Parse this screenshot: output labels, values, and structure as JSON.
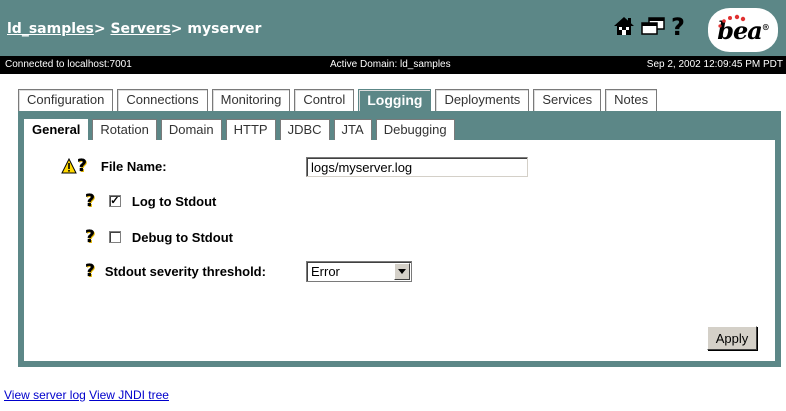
{
  "breadcrumb": {
    "domain": "ld_samples",
    "sep1": ">",
    "servers": "Servers",
    "sep2": ">",
    "server": "myserver"
  },
  "header": {
    "icons": [
      "home-icon",
      "windows-icon",
      "help-icon"
    ],
    "help_glyph": "?",
    "logo_text": "bea",
    "logo_mark": "®",
    "colors": {
      "header_bg": "#5c8787",
      "status_bg": "#000000",
      "link": "#0000cc"
    }
  },
  "status": {
    "connection": "Connected to localhost:7001",
    "domain": "Active Domain: ld_samples",
    "timestamp": "Sep 2, 2002 12:09:45 PM PDT"
  },
  "tabs": [
    {
      "label": "Configuration",
      "active": false
    },
    {
      "label": "Connections",
      "active": false
    },
    {
      "label": "Monitoring",
      "active": false
    },
    {
      "label": "Control",
      "active": false
    },
    {
      "label": "Logging",
      "active": true
    },
    {
      "label": "Deployments",
      "active": false
    },
    {
      "label": "Services",
      "active": false
    },
    {
      "label": "Notes",
      "active": false
    }
  ],
  "subtabs": [
    {
      "label": "General",
      "active": true
    },
    {
      "label": "Rotation",
      "active": false
    },
    {
      "label": "Domain",
      "active": false
    },
    {
      "label": "HTTP",
      "active": false
    },
    {
      "label": "JDBC",
      "active": false
    },
    {
      "label": "JTA",
      "active": false
    },
    {
      "label": "Debugging",
      "active": false
    }
  ],
  "form": {
    "help_glyph": "?",
    "file_name": {
      "label": "File Name:",
      "value": "logs/myserver.log"
    },
    "log_to_stdout": {
      "label": "Log to Stdout",
      "checked": true,
      "check_glyph": "✓"
    },
    "debug_to_stdout": {
      "label": "Debug to Stdout",
      "checked": false
    },
    "severity": {
      "label": "Stdout severity threshold:",
      "selected": "Error"
    },
    "apply_label": "Apply"
  },
  "footer": {
    "view_log": "View server log",
    "view_jndi": "View JNDI tree"
  }
}
